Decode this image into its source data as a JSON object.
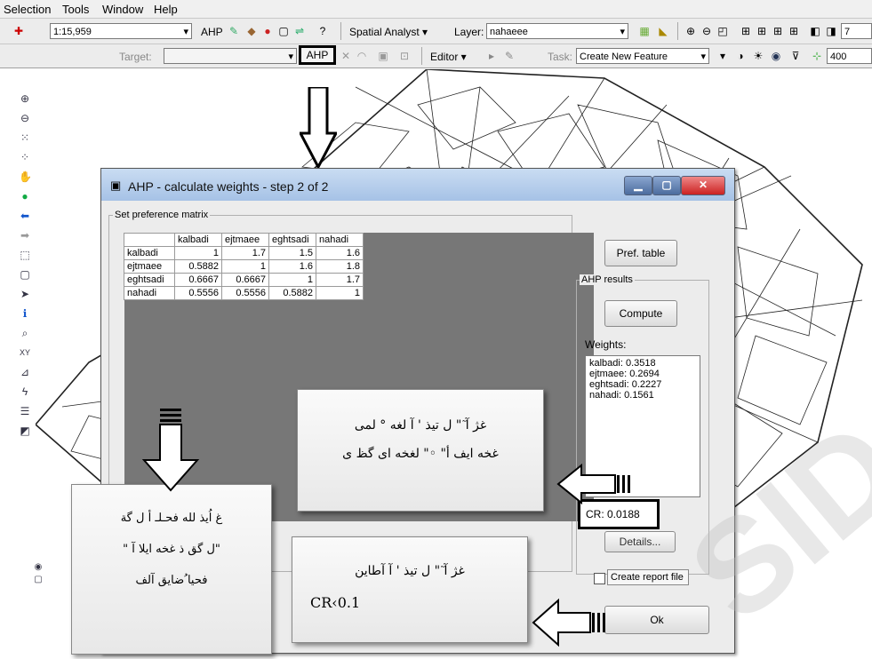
{
  "menu": [
    "Selection",
    "Tools",
    "Window",
    "Help"
  ],
  "toolbar1": {
    "scale": "1:15,959",
    "ahp_label": "AHP",
    "spatial_analyst": "Spatial Analyst ▾",
    "layer_label": "Layer:",
    "layer_value": "nahaeee",
    "right_field": "7"
  },
  "toolbar2": {
    "target_label": "Target:",
    "ahp_button": "AHP",
    "editor": "Editor ▾",
    "task_label": "Task:",
    "task_value": "Create New Feature",
    "right_field": "400"
  },
  "dialog": {
    "title": "AHP - calculate weights - step 2 of 2",
    "group_label": "Set preference matrix",
    "matrix": {
      "headers": [
        "",
        "kalbadi",
        "ejtmaee",
        "eghtsadi",
        "nahadi"
      ],
      "rows": [
        [
          "kalbadi",
          "1",
          "1.7",
          "1.5",
          "1.6"
        ],
        [
          "ejtmaee",
          "0.5882",
          "1",
          "1.6",
          "1.8"
        ],
        [
          "eghtsadi",
          "0.6667",
          "0.6667",
          "1",
          "1.7"
        ],
        [
          "nahadi",
          "0.5556",
          "0.5556",
          "0.5882",
          "1"
        ]
      ]
    },
    "pref_table": "Pref. table",
    "results_group": "AHP results",
    "compute": "Compute",
    "weights_label": "Weights:",
    "weights": [
      "kalbadi: 0.3518",
      "ejtmaee: 0.2694",
      "eghtsadi: 0.2227",
      "nahadi: 0.1561"
    ],
    "cr": "CR: 0.0188",
    "details": "Details...",
    "create_report": "Create report file",
    "ok": "Ok"
  },
  "annotations": {
    "box1_line1": "غژ آ ٓ\" ل تیذ ' آ لغه ° لمی",
    "box1_line2": "غخه ایف أ\" ◦\" لغخه ای گظ ی",
    "box2_line1": "غ اُیذ لله فحـلـ أ ل گة",
    "box2_line2": "\" ل گق ذ غخه ایلا آ\"",
    "box2_line3": "فحیا ُضایق آلف",
    "box3_line1": "غژ آ ٓ\" ل تیذ ' آ آطاین",
    "box3_line2": "CR‹0.1"
  },
  "watermark": "SID"
}
